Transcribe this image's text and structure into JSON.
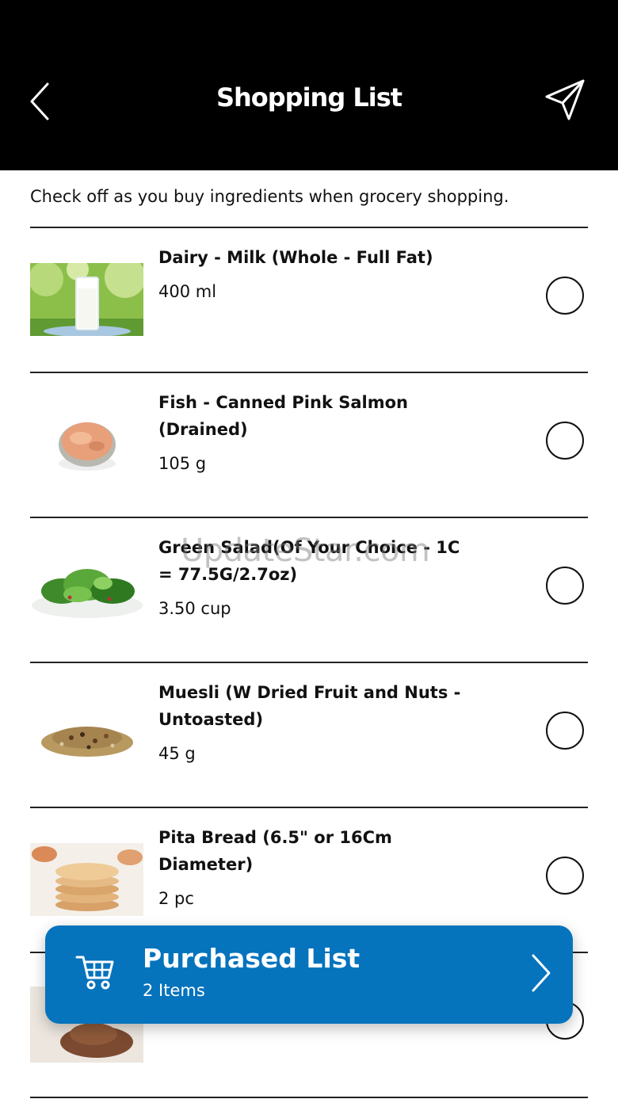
{
  "header": {
    "title": "Shopping List",
    "back_icon": "chevron-left-icon",
    "send_icon": "paper-plane-icon"
  },
  "intro": "Check off as you buy ingredients when grocery shopping.",
  "items": [
    {
      "name": "Dairy - Milk (Whole - Full Fat)",
      "qty": "400 ml",
      "checked": false,
      "image": "glass-of-milk"
    },
    {
      "name": "Fish - Canned Pink Salmon (Drained)",
      "qty": "105 g",
      "checked": false,
      "image": "canned-salmon"
    },
    {
      "name": "Green Salad(Of Your Choice - 1C = 77.5G/2.7oz)",
      "qty": "3.50 cup",
      "checked": false,
      "image": "green-salad-plate"
    },
    {
      "name": "Muesli (W Dried Fruit and Nuts - Untoasted)",
      "qty": "45 g",
      "checked": false,
      "image": "muesli-pile"
    },
    {
      "name": "Pita Bread (6.5\" or 16Cm Diameter)",
      "qty": "2 pc",
      "checked": false,
      "image": "pita-bread-stack"
    },
    {
      "name": "",
      "qty": "",
      "checked": false,
      "image": "cocoa-powder"
    }
  ],
  "watermark": "UpdateStar.com",
  "purchased": {
    "title": "Purchased List",
    "count": "2 Items",
    "icon": "shopping-cart-icon",
    "accent": "#0673bd"
  }
}
